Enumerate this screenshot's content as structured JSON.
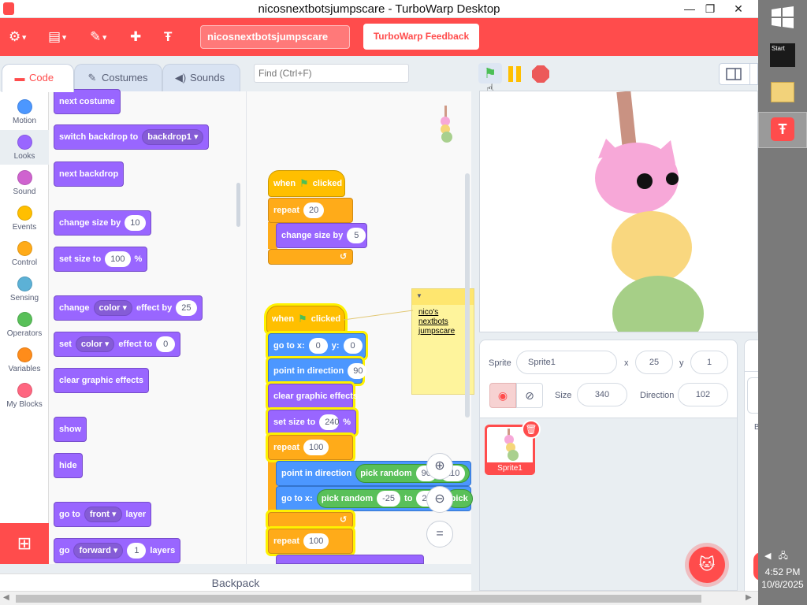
{
  "window": {
    "title": "nicosnextbotsjumpscare - TurboWarp Desktop",
    "minimize": "—",
    "maximize": "❐",
    "close": "✕"
  },
  "menubar": {
    "settings_icon": "gear-icon",
    "file_icon": "file-icon",
    "edit_icon": "pencil-icon",
    "addons_icon": "puzzle-icon",
    "turbowarp_icon": "turbowarp-logo-icon",
    "project_title": "nicosnextbotsjumpscare",
    "feedback_label": "TurboWarp Feedback"
  },
  "tabs": [
    {
      "label": "Code",
      "icon": "code-icon"
    },
    {
      "label": "Costumes",
      "icon": "brush-icon"
    },
    {
      "label": "Sounds",
      "icon": "speaker-icon"
    }
  ],
  "find": {
    "placeholder": "Find (Ctrl+F)"
  },
  "categories": [
    {
      "label": "Motion",
      "color": "#4c97ff"
    },
    {
      "label": "Looks",
      "color": "#9966ff"
    },
    {
      "label": "Sound",
      "color": "#cf63cf"
    },
    {
      "label": "Events",
      "color": "#ffbf00"
    },
    {
      "label": "Control",
      "color": "#ffab19"
    },
    {
      "label": "Sensing",
      "color": "#5cb1d6"
    },
    {
      "label": "Operators",
      "color": "#59c059"
    },
    {
      "label": "Variables",
      "color": "#ff8c1a"
    },
    {
      "label": "My Blocks",
      "color": "#ff6680"
    }
  ],
  "palette": {
    "next_costume": "next costume",
    "switch_backdrop": "switch backdrop to",
    "backdrop_value": "backdrop1",
    "next_backdrop": "next backdrop",
    "change_size_by": "change size by",
    "change_size_value": "10",
    "set_size_to": "set size to",
    "set_size_value": "100",
    "percent": "%",
    "change": "change",
    "effect_color": "color",
    "effect_by": "effect by",
    "effect_by_value": "25",
    "set": "set",
    "effect_to": "effect to",
    "effect_to_value": "0",
    "clear_effects": "clear graphic effects",
    "show": "show",
    "hide": "hide",
    "go_to": "go to",
    "front": "front",
    "layer": "layer",
    "go": "go",
    "forward": "forward",
    "layers_value": "1",
    "layers": "layers"
  },
  "script1": {
    "when": "when",
    "clicked": "clicked",
    "repeat": "repeat",
    "repeat_value": "20",
    "change_size_by": "change size by",
    "change_value": "5"
  },
  "script2": {
    "when": "when",
    "clicked": "clicked",
    "go_to_x": "go to x:",
    "x_value": "0",
    "y_label": "y:",
    "y_value": "0",
    "point_dir": "point in direction",
    "dir_value": "90",
    "clear_effects": "clear graphic effects",
    "set_size_to": "set size to",
    "size_value": "240",
    "percent": "%",
    "repeat": "repeat",
    "repeat_value": "100",
    "point_dir2": "point in direction",
    "pick_random": "pick random",
    "rand1_value": "90",
    "rand1_to_value": "110",
    "go_to_x2": "go to x:",
    "pick_random2": "pick random",
    "rand2_from": "-25",
    "to": "to",
    "rand2_to": "25",
    "pick": "pick",
    "repeat2": "repeat",
    "repeat2_value": "100"
  },
  "comment": {
    "text": "nico's nextbots jumpscare"
  },
  "zoom": {
    "in_icon": "zoom-in-icon",
    "out_icon": "zoom-out-icon",
    "reset": "="
  },
  "backpack": "Backpack",
  "sprite_info": {
    "sprite_label": "Sprite",
    "sprite_name": "Sprite1",
    "x_label": "x",
    "x_value": "25",
    "y_label": "y",
    "y_value": "1",
    "show_icon": "eye-icon",
    "hide_icon": "eye-slash-icon",
    "size_label": "Size",
    "size_value": "340",
    "direction_label": "Direction",
    "direction_value": "102"
  },
  "sprite_tile": {
    "name": "Sprite1"
  },
  "stage_pane": {
    "label": "B"
  },
  "taskbar": {
    "start_label": "Start",
    "time": "4:52 PM",
    "date": "10/8/2025"
  },
  "colors": {
    "turbowarp_red": "#ff4c4c",
    "looks": "#9966ff",
    "events": "#ffbf00",
    "control": "#ffab19",
    "motion": "#4c97ff",
    "operators": "#59c059"
  }
}
